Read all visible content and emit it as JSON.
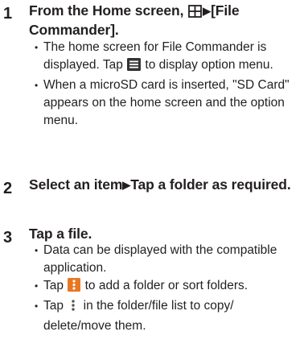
{
  "steps": [
    {
      "number": "1",
      "title_pre": "From the Home screen, ",
      "title_icon": "apps-grid-icon",
      "title_arrow": "▶",
      "title_post": "[File Commander].",
      "bullets": [
        {
          "pre": "The home screen for File Commander is displayed. Tap ",
          "icon": "menu-list-icon",
          "post": " to display option menu."
        },
        {
          "text": "When a microSD card is inserted, \"SD Card\" appears on the home screen and the option menu."
        }
      ]
    },
    {
      "number": "2",
      "title_pre": "Select an item",
      "title_arrow": "▶",
      "title_post": "Tap a folder as required."
    },
    {
      "number": "3",
      "title": "Tap a file.",
      "bullets": [
        {
          "text": "Data can be displayed with the compatible application."
        },
        {
          "pre": "Tap ",
          "icon": "overflow-menu-icon",
          "post": " to add a folder or sort folders."
        },
        {
          "pre": "Tap ",
          "icon": "vertical-dots-icon",
          "post": " in the folder/file list to copy/ delete/move them."
        }
      ]
    }
  ],
  "colors": {
    "text": "#231f20",
    "icon_dark": "#333333",
    "icon_accent": "#e87722"
  }
}
